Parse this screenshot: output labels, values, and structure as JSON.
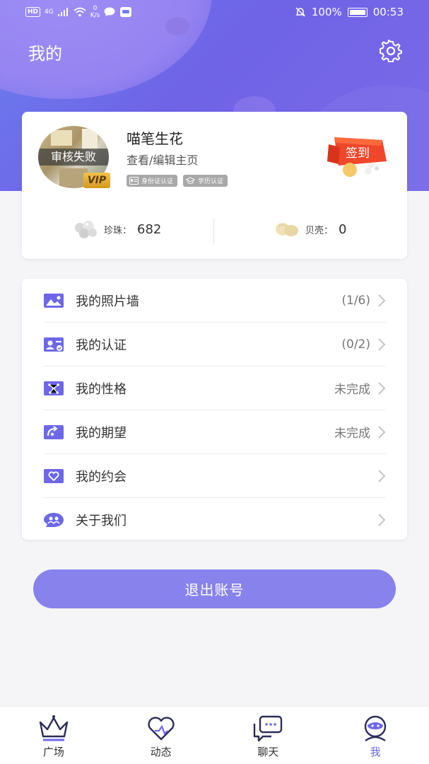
{
  "status_bar": {
    "left_badge": "HD",
    "network": "4G",
    "speed_value": "0",
    "speed_unit": "K/s",
    "battery": "100%",
    "time": "00:53"
  },
  "header": {
    "title": "我的"
  },
  "profile": {
    "avatar_status": "审核失败",
    "vip_label": "VIP",
    "nickname": "喵笔生花",
    "edit_link": "查看/编辑主页",
    "badges": [
      "身份证认证",
      "学历认证"
    ],
    "signin_label": "签到",
    "pearls_label": "珍珠：",
    "pearls_value": "682",
    "shells_label": "贝壳：",
    "shells_value": "0"
  },
  "menu": {
    "items": [
      {
        "label": "我的照片墙",
        "value": "(1/6)",
        "icon": "photo-wall-icon"
      },
      {
        "label": "我的认证",
        "value": "(0/2)",
        "icon": "id-card-icon"
      },
      {
        "label": "我的性格",
        "value": "未完成",
        "icon": "personality-icon"
      },
      {
        "label": "我的期望",
        "value": "未完成",
        "icon": "expectation-icon"
      },
      {
        "label": "我的约会",
        "value": "",
        "icon": "date-heart-icon"
      },
      {
        "label": "关于我们",
        "value": "",
        "icon": "about-us-icon"
      }
    ]
  },
  "logout_label": "退出账号",
  "tabs": [
    {
      "label": "广场",
      "icon": "crown-icon",
      "active": false
    },
    {
      "label": "动态",
      "icon": "heart-icon",
      "active": false
    },
    {
      "label": "聊天",
      "icon": "chat-icon",
      "active": false
    },
    {
      "label": "我",
      "icon": "profile-icon",
      "active": true
    }
  ],
  "colors": {
    "accent": "#6e67e8",
    "button": "#8782ec",
    "header_start": "#6a7ff0",
    "header_end": "#7b6ae8"
  }
}
